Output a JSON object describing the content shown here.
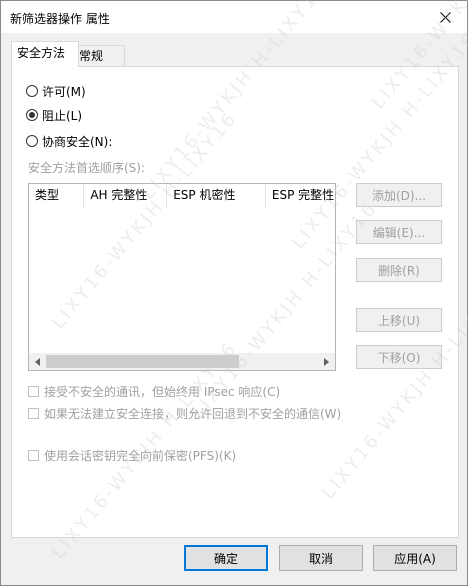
{
  "window": {
    "title": "新筛选器操作 属性",
    "close_icon": "close-icon"
  },
  "tabs": [
    {
      "label": "安全方法",
      "active": true
    },
    {
      "label": "常规",
      "active": false
    }
  ],
  "actions": {
    "options": [
      {
        "label": "许可(M)",
        "checked": false
      },
      {
        "label": "阻止(L)",
        "checked": true
      },
      {
        "label": "协商安全(N):",
        "checked": false
      }
    ]
  },
  "methods": {
    "list_label": "安全方法首选顺序(S):",
    "columns": [
      "类型",
      "AH 完整性",
      "ESP 机密性",
      "ESP 完整性"
    ],
    "rows": []
  },
  "side_buttons": {
    "add": "添加(D)...",
    "edit": "编辑(E)...",
    "remove": "删除(R)",
    "up": "上移(U)",
    "down": "下移(O)"
  },
  "checkboxes": [
    {
      "label": "接受不安全的通讯，但始终用 IPsec 响应(C)",
      "checked": false,
      "enabled": false
    },
    {
      "label": "如果无法建立安全连接，则允许回退到不安全的通信(W)",
      "checked": false,
      "enabled": false
    },
    {
      "label": "使用会话密钥完全向前保密(PFS)(K)",
      "checked": false,
      "enabled": false
    }
  ],
  "footer": {
    "ok": "确定",
    "cancel": "取消",
    "apply": "应用(A)"
  },
  "watermark_text": "LIXY16-WYKJH H-LIXY16",
  "colors": {
    "dialog_bg": "#f0f0f0",
    "panel_bg": "#ffffff",
    "disabled_text": "#a0a0a0",
    "accent": "#0078d7"
  }
}
